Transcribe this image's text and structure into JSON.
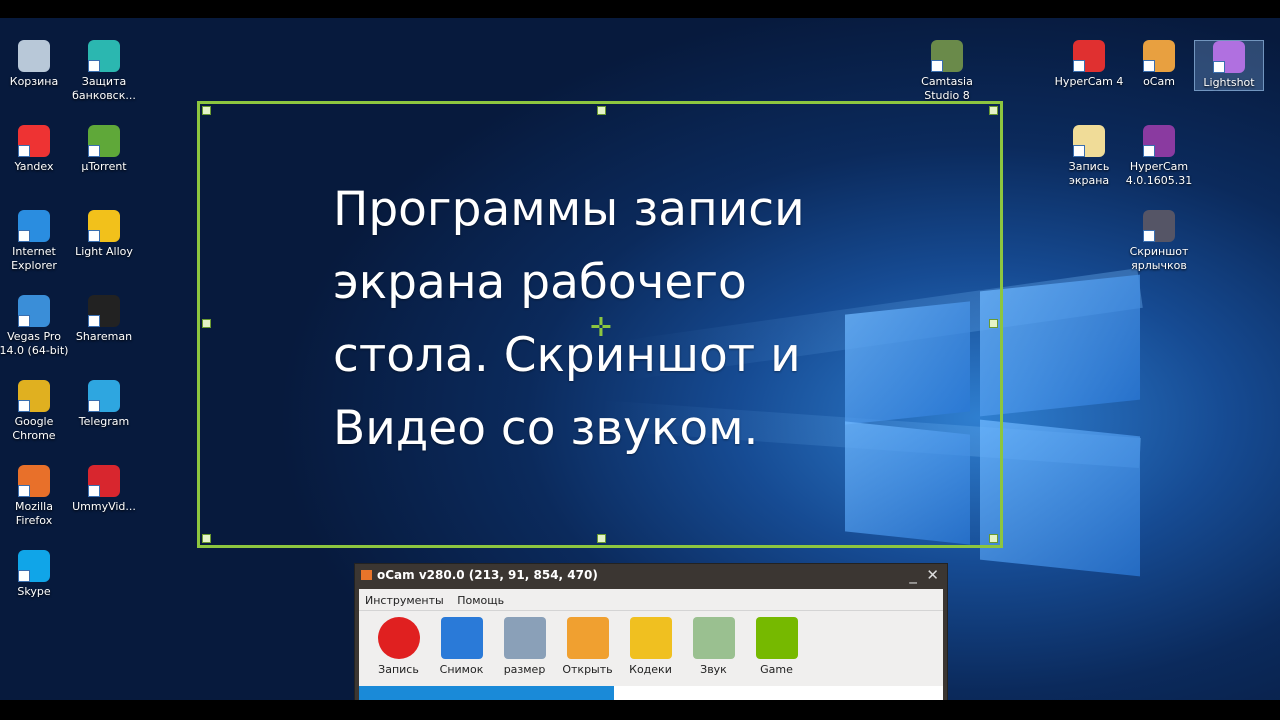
{
  "desktop_icons_left": [
    {
      "label": "Корзина",
      "icon": "recycle-bin-icon",
      "color": "#b8c8d8"
    },
    {
      "label": "Защита банковск...",
      "icon": "bank-protection-icon",
      "color": "#2bb7b0"
    },
    {
      "label": "Yandex",
      "icon": "yandex-browser-icon",
      "color": "#e33"
    },
    {
      "label": "µTorrent",
      "icon": "utorrent-icon",
      "color": "#5fa839"
    },
    {
      "label": "Internet Explorer",
      "icon": "internet-explorer-icon",
      "color": "#2a8de0"
    },
    {
      "label": "Light Alloy",
      "icon": "light-alloy-icon",
      "color": "#f2c11b"
    },
    {
      "label": "Vegas Pro 14.0 (64-bit)",
      "icon": "vegas-pro-icon",
      "color": "#3a8ed8"
    },
    {
      "label": "Shareman",
      "icon": "shareman-icon",
      "color": "#222"
    },
    {
      "label": "Google Chrome",
      "icon": "chrome-icon",
      "color": "#e0b020"
    },
    {
      "label": "Telegram",
      "icon": "telegram-icon",
      "color": "#2ea6e0"
    },
    {
      "label": "Mozilla Firefox",
      "icon": "firefox-icon",
      "color": "#e8702a"
    },
    {
      "label": "UmmyVid...",
      "icon": "ummy-video-icon",
      "color": "#d8262e"
    },
    {
      "label": "Skype",
      "icon": "skype-icon",
      "color": "#10a5e8"
    }
  ],
  "desktop_icons_right": [
    {
      "label": "Camtasia Studio 8",
      "icon": "camtasia-icon",
      "color": "#6a8a4a"
    },
    {
      "label": "HyperCam 4",
      "icon": "hypercam-icon",
      "color": "#e03030"
    },
    {
      "label": "oCam",
      "icon": "ocam-icon",
      "color": "#e8a040"
    },
    {
      "label": "Lightshot",
      "icon": "lightshot-icon",
      "color": "#b070e0"
    },
    {
      "label": "Запись экрана",
      "icon": "folder-icon",
      "color": "#f0dc98"
    },
    {
      "label": "HyperCam 4.0.1605.31",
      "icon": "winrar-archive-icon",
      "color": "#8a3aa0"
    },
    {
      "label": "Скриншот ярлычков",
      "icon": "image-file-icon",
      "color": "#556"
    }
  ],
  "headline": [
    "Программы записи",
    "экрана рабочего",
    "стола. Скриншот и",
    "Видео со звуком."
  ],
  "selection_color": "#8dc63f",
  "ocam": {
    "title": "oCam v280.0 (213, 91, 854, 470)",
    "minimize": "_",
    "close": "✕",
    "menu": [
      "Инструменты",
      "Помощь"
    ],
    "tools": [
      {
        "label": "Запись",
        "icon": "record-icon",
        "color": "#e02020"
      },
      {
        "label": "Снимок",
        "icon": "monitor-icon",
        "color": "#2a7ad8"
      },
      {
        "label": "размер",
        "icon": "resize-icon",
        "color": "#8aa0b8"
      },
      {
        "label": "Открыть",
        "icon": "folder-open-icon",
        "color": "#f0a030"
      },
      {
        "label": "Кодеки",
        "icon": "codec-film-icon",
        "color": "#f0c020"
      },
      {
        "label": "Звук",
        "icon": "microphone-icon",
        "color": "#9ac090"
      },
      {
        "label": "Game",
        "icon": "nvidia-game-icon",
        "color": "#76b900"
      }
    ]
  }
}
